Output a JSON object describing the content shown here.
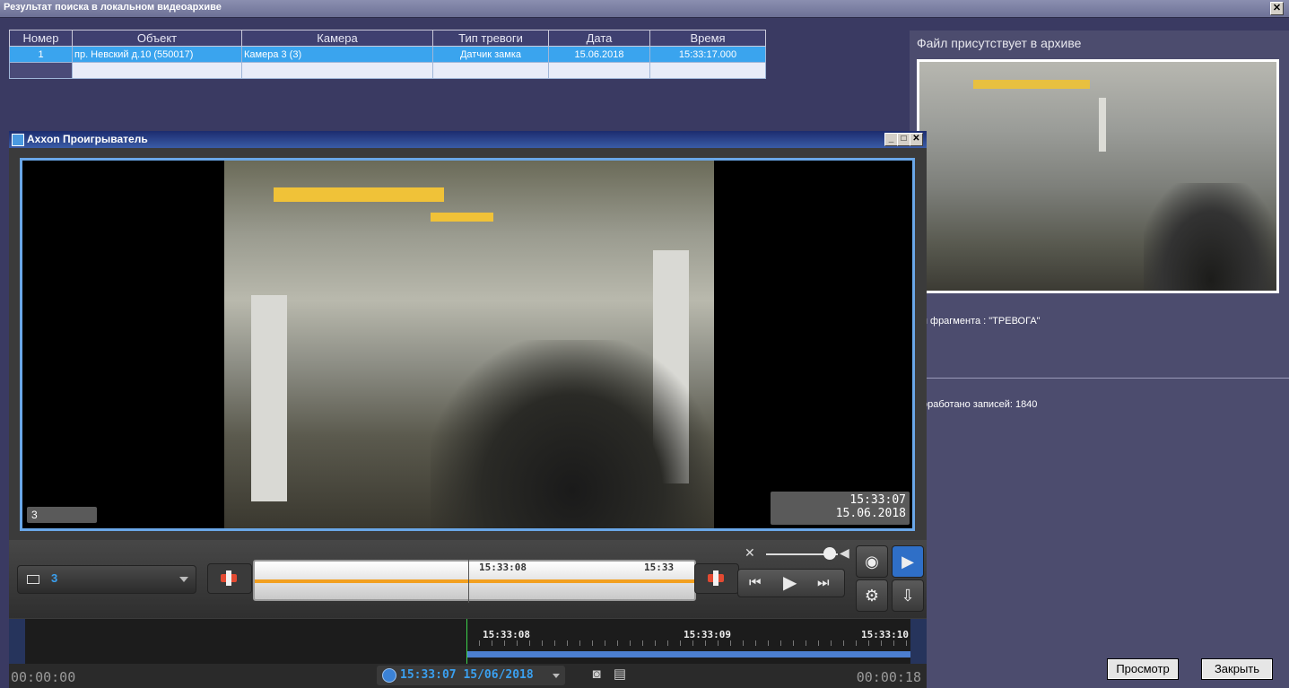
{
  "window": {
    "title": "Результат поиска в локальном видеоархиве",
    "close": "✕"
  },
  "table": {
    "headers": [
      "Номер",
      "Объект",
      "Камера",
      "Тип тревоги",
      "Дата",
      "Время"
    ],
    "rows": [
      [
        "1",
        "пр. Невский д.10 (550017)",
        "Камера 3 (3)",
        "Датчик замка",
        "15.06.2018",
        "15:33:17.000"
      ]
    ]
  },
  "right_panel": {
    "title": "Файл присутствует в архиве",
    "fragment_type": "п фрагмента : \"ТРЕВОГА\"",
    "processed": "оработано записей: 1840",
    "view_button": "Просмотр",
    "close_button": "Закрыть"
  },
  "player": {
    "title": "Axxon Проигрыватель",
    "min": "_",
    "max": "□",
    "close": "✕",
    "camera_label": "3",
    "timestamp_time": "15:33:07",
    "timestamp_date": "15.06.2018",
    "camera_selector": "3",
    "small_timeline": {
      "label_left": "15:33:08",
      "label_right": "15:33"
    },
    "timeline": {
      "label_1": "15:33:08",
      "label_2": "15:33:09",
      "label_3": "15:33:10"
    },
    "status": {
      "time_left": "00:00:00",
      "current": "15:33:07 15/06/2018",
      "time_right": "00:00:18"
    },
    "volume_level": 0.85
  },
  "colors": {
    "accent": "#3aa4ee",
    "selection": "#3aa4ee",
    "cursor": "#3cd24a",
    "orange": "#f2a020"
  }
}
